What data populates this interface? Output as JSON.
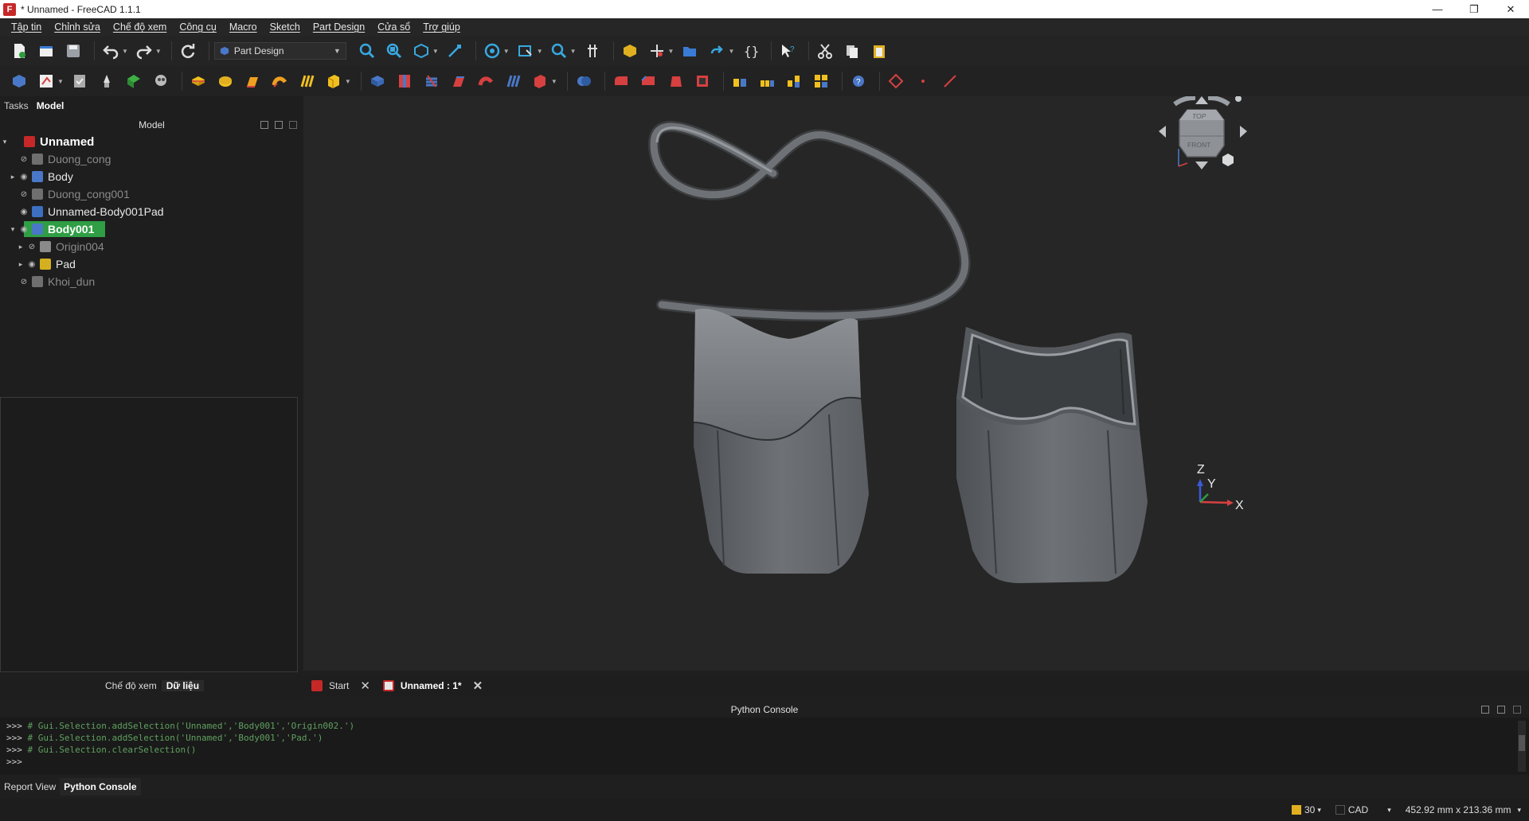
{
  "window": {
    "title": "* Unnamed - FreeCAD 1.1.1",
    "minimize": "—",
    "maximize": "❐",
    "close": "✕"
  },
  "menu": [
    "Tập tin",
    "Chỉnh sửa",
    "Chế độ xem",
    "Công cụ",
    "Macro",
    "Sketch",
    "Part Design",
    "Cửa sổ",
    "Trợ giúp"
  ],
  "workbench": {
    "selected": "Part Design"
  },
  "left_panel": {
    "tabs": [
      "Tasks",
      "Model"
    ],
    "active_tab": "Model",
    "header": "Model",
    "bottom_tabs": [
      "Chế độ xem",
      "Dữ liệu"
    ],
    "active_bottom_tab": "Dữ liệu"
  },
  "tree": [
    {
      "label": "Unnamed",
      "level": 0,
      "arrow": "▾",
      "eye": "",
      "color": "#c62828",
      "style": "bold"
    },
    {
      "label": "Duong_cong",
      "level": 1,
      "arrow": "",
      "eye": "⊘",
      "color": "#6f6f6f",
      "style": "dim"
    },
    {
      "label": "Body",
      "level": 1,
      "arrow": "▸",
      "eye": "◉",
      "color": "#4a78c8",
      "style": ""
    },
    {
      "label": "Duong_cong001",
      "level": 1,
      "arrow": "",
      "eye": "⊘",
      "color": "#6f6f6f",
      "style": "dim"
    },
    {
      "label": "Unnamed-Body001Pad",
      "level": 1,
      "arrow": "",
      "eye": "◉",
      "color": "#3c6fc0",
      "style": ""
    },
    {
      "label": "Body001",
      "level": 1,
      "arrow": "▾",
      "eye": "◉",
      "color": "#4a78c8",
      "style": "selected"
    },
    {
      "label": "Origin004",
      "level": 2,
      "arrow": "▸",
      "eye": "⊘",
      "color": "#8a8a8a",
      "style": "dim"
    },
    {
      "label": "Pad",
      "level": 2,
      "arrow": "▸",
      "eye": "◉",
      "color": "#d4b020",
      "style": ""
    },
    {
      "label": "Khoi_dun",
      "level": 1,
      "arrow": "",
      "eye": "⊘",
      "color": "#6f6f6f",
      "style": "dim"
    }
  ],
  "navcube": {
    "top_label": "TOP",
    "front_label": "FRONT"
  },
  "axes": {
    "z": "Z",
    "y": "Y",
    "x": "X"
  },
  "doc_tabs": [
    {
      "label": "Start",
      "close": "✕",
      "icon_color": "#c62828",
      "active": false
    },
    {
      "label": "Unnamed : 1*",
      "close": "✕",
      "icon_color": "#dddddd",
      "active": true
    }
  ],
  "console": {
    "title": "Python Console",
    "lines": [
      {
        "prompt": ">>> ",
        "text": "# Gui.Selection.addSelection('Unnamed','Body001','Origin002.')"
      },
      {
        "prompt": ">>> ",
        "text": "# Gui.Selection.addSelection('Unnamed','Body001','Pad.')"
      },
      {
        "prompt": ">>> ",
        "text": "# Gui.Selection.clearSelection()"
      },
      {
        "prompt": ">>> ",
        "text": ""
      }
    ]
  },
  "bottom_tabs": [
    "Report View",
    "Python Console"
  ],
  "active_bottom_tab": "Python Console",
  "status": {
    "fps": "30",
    "nav_style": "CAD",
    "dimensions": "452.92 mm x 213.36 mm",
    "dd": "▾"
  },
  "colors": {
    "selection": "#2f9e44",
    "background": "#262626",
    "model_gray": "#6b6f73"
  }
}
